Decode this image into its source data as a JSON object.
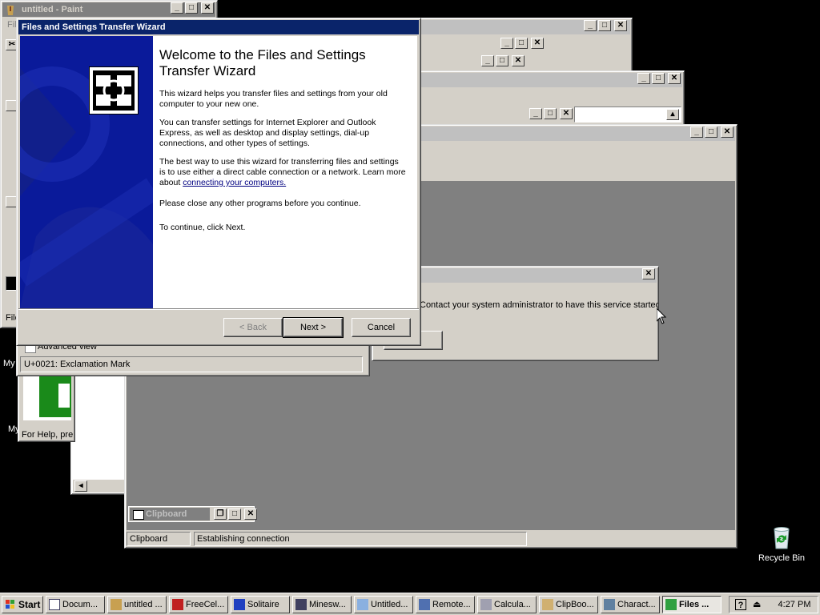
{
  "paint": {
    "title": "untitled - Paint",
    "menu_label": "File",
    "status": "For Help, pre"
  },
  "charmap": {
    "advanced_label": "Advanced view",
    "status": "U+0021: Exclamation Mark"
  },
  "clipbook": {
    "title": "Clipboard",
    "status_left": "Clipboard",
    "status_right": "Establishing connection"
  },
  "error": {
    "message": "Contact your system administrator to have this service started."
  },
  "wizard": {
    "title": "Files and Settings Transfer Wizard",
    "heading_line1": "Welcome to the Files and Settings",
    "heading_line2": "Transfer Wizard",
    "p1": "This wizard helps you transfer files and settings from your old computer to your new one.",
    "p2": "You can transfer settings for Internet Explorer and Outlook Express, as well as desktop and display settings, dial-up connections, and other types of settings.",
    "p3_text": "The best way to use this wizard for transferring files and settings is to use either a direct cable connection or a network. Learn more about ",
    "p3_link": "connecting your computers.",
    "p4": "Please close any other programs before you continue.",
    "p5": "To continue, click Next.",
    "back_label": "< Back",
    "next_label": "Next >",
    "cancel_label": "Cancel"
  },
  "desktop": {
    "recycle_bin": "Recycle Bin",
    "icon1_label": "My",
    "icon2_label": "My"
  },
  "taskbar": {
    "start_label": "Start",
    "items": [
      "Docum...",
      "untitled ...",
      "FreeCel...",
      "Solitaire",
      "Minesw...",
      "Untitled...",
      "Remote...",
      "Calcula...",
      "ClipBoo...",
      "Charact...",
      "Files ..."
    ],
    "clock": "4:27 PM"
  },
  "colors": {
    "titlebar_active": "#0a246a",
    "titlebar_inactive": "#808080",
    "face": "#d4d0c8",
    "desktop": "#000000"
  }
}
